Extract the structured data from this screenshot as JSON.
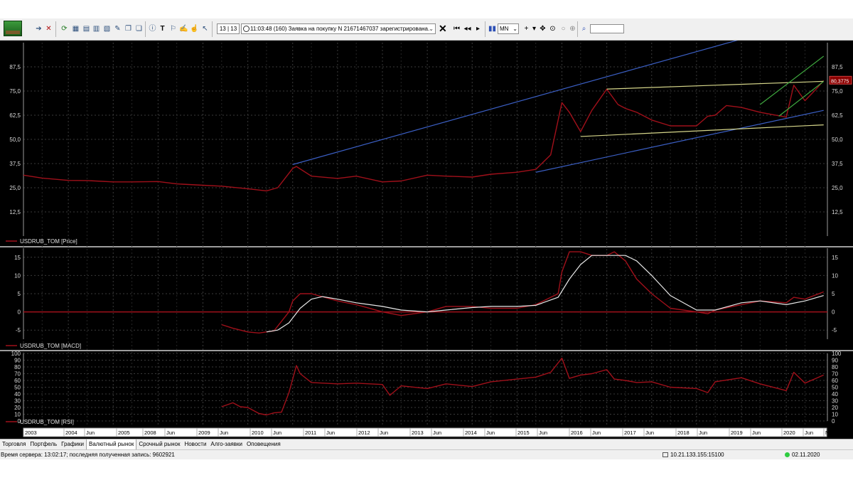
{
  "toolbar": {
    "counter": "13 | 13",
    "message": "11:03:48  (160) Заявка на покупку N 21671467037 зарегистрирована.",
    "timeframe": "MN",
    "icons": [
      "logo-icon",
      "arrow-right-icon",
      "cancel-order-icon",
      "refresh-icon",
      "table-icon",
      "table-icon",
      "table-icon",
      "chart-icon",
      "edit-icon",
      "copy-icon",
      "info-icon",
      "text-tool-icon",
      "draw-tool-icon",
      "draw-tool-icon",
      "draw-tool-icon",
      "cursor-icon",
      "first-icon",
      "prev-icon",
      "next-icon",
      "last-icon",
      "candles-icon",
      "crosshair-icon",
      "move-icon",
      "target-icon",
      "circle-icon",
      "zoom-icon",
      "search-icon"
    ]
  },
  "tabs": [
    "Торговля",
    "Портфель",
    "Графики",
    "Валютный рынок",
    "Срочный рынок",
    "Новости",
    "Алго-заявки",
    "Оповещения"
  ],
  "active_tab": "Валютный рынок",
  "status": {
    "server_time": "Время сервера: 13:02:17; последняя полученная запись: 9602921",
    "connection": "10.21.133.155:15100",
    "date": "02.11.2020"
  },
  "colors": {
    "price_line": "#a0101a",
    "signal_line": "#e8e8e8",
    "trend_blue": "#3b5fc4",
    "trend_yellow": "#d6d68a",
    "trend_green": "#3fa83f",
    "grid": "#3a3a3a",
    "zero_line": "#a0101a"
  },
  "chart_data": [
    {
      "type": "line",
      "legend": "USDRUB_TOM [Price]",
      "ylim": [
        0,
        100
      ],
      "yticks": [
        "12,5",
        "25,0",
        "37,5",
        "50,0",
        "62,5",
        "75,0",
        "87,5"
      ],
      "last_value": "80,3775",
      "x": [
        "2003-01",
        "2003-06",
        "2004-01",
        "2004-06",
        "2005-01",
        "2005-06",
        "2006-01",
        "2006-06",
        "2007-01",
        "2007-06",
        "2008-01",
        "2008-06",
        "2008-09",
        "2009-01",
        "2009-02",
        "2009-06",
        "2010-01",
        "2010-06",
        "2011-01",
        "2011-06",
        "2012-01",
        "2012-06",
        "2013-01",
        "2013-06",
        "2014-01",
        "2014-06",
        "2014-10",
        "2014-12",
        "2015-01",
        "2015-03",
        "2015-06",
        "2015-09",
        "2016-01",
        "2016-04",
        "2016-06",
        "2016-09",
        "2017-01",
        "2017-06",
        "2018-01",
        "2018-04",
        "2018-06",
        "2018-09",
        "2019-01",
        "2019-06",
        "2020-01",
        "2020-03",
        "2020-06",
        "2020-09",
        "2020-11"
      ],
      "values": [
        31.5,
        30,
        28.8,
        28.7,
        28,
        28,
        28.2,
        27,
        26.3,
        25.8,
        24.5,
        23.4,
        25,
        35,
        36,
        31,
        29.8,
        31,
        28,
        28.5,
        31.5,
        31,
        30.5,
        32,
        33,
        34.5,
        42,
        60,
        69,
        64,
        54,
        65,
        76,
        68,
        66,
        64,
        60,
        57,
        57,
        62,
        62.5,
        67.5,
        66.5,
        64,
        61.5,
        78,
        70,
        76,
        80.4
      ]
    },
    {
      "type": "line",
      "legend": "USDRUB_TOM [MACD]",
      "ylim": [
        -7.5,
        17.5
      ],
      "yticks": [
        "-5",
        "0",
        "5",
        "10",
        "15"
      ],
      "series": [
        {
          "x": [
            "2007-06",
            "2007-09",
            "2008-01",
            "2008-04",
            "2008-08",
            "2008-12",
            "2009-01",
            "2009-03",
            "2009-06",
            "2010-01",
            "2010-06",
            "2011-01",
            "2011-06",
            "2012-01",
            "2012-06",
            "2013-01",
            "2013-06",
            "2014-01",
            "2014-06",
            "2014-12",
            "2015-01",
            "2015-03",
            "2015-06",
            "2015-09",
            "2016-01",
            "2016-03",
            "2016-06",
            "2016-09",
            "2017-01",
            "2017-06",
            "2018-01",
            "2018-04",
            "2018-06",
            "2019-01",
            "2019-06",
            "2020-01",
            "2020-03",
            "2020-06",
            "2020-11"
          ],
          "values": [
            -3.5,
            -4.5,
            -5.5,
            -5.8,
            -5.2,
            0,
            3,
            5,
            5,
            3,
            2,
            0,
            -1,
            0,
            1.5,
            1.5,
            1,
            1,
            2,
            5,
            11,
            16.5,
            16.5,
            15.5,
            15.5,
            16.5,
            14,
            9,
            5,
            1,
            0,
            -0.5,
            0.5,
            2,
            3,
            2.5,
            4,
            3.5,
            5.5
          ]
        },
        {
          "x": [
            "2008-06",
            "2008-09",
            "2008-12",
            "2009-03",
            "2009-06",
            "2009-09",
            "2010-01",
            "2010-06",
            "2011-01",
            "2011-06",
            "2012-01",
            "2012-06",
            "2013-01",
            "2013-06",
            "2014-01",
            "2014-06",
            "2014-12",
            "2015-03",
            "2015-06",
            "2015-09",
            "2016-01",
            "2016-03",
            "2016-06",
            "2016-09",
            "2017-01",
            "2017-06",
            "2018-01",
            "2018-06",
            "2019-01",
            "2019-06",
            "2020-01",
            "2020-06",
            "2020-11"
          ],
          "values": [
            -5.5,
            -5,
            -3,
            1,
            3.5,
            4.2,
            3.5,
            2.5,
            1.5,
            0.5,
            0,
            0.5,
            1.2,
            1.5,
            1.5,
            1.8,
            4,
            9,
            13,
            15.5,
            15.5,
            15.5,
            15.5,
            14,
            10,
            4.5,
            0.5,
            0.5,
            2.5,
            3,
            2,
            3,
            4.5
          ]
        }
      ]
    },
    {
      "type": "line",
      "legend": "USDRUB_TOM [RSI]",
      "ylim": [
        0,
        100
      ],
      "yticks": [
        "0",
        "10",
        "20",
        "30",
        "40",
        "50",
        "60",
        "70",
        "80",
        "90",
        "100"
      ],
      "x": [
        "2007-06",
        "2007-09",
        "2007-11",
        "2008-01",
        "2008-04",
        "2008-06",
        "2008-08",
        "2008-10",
        "2008-12",
        "2009-02",
        "2009-03",
        "2009-06",
        "2010-01",
        "2010-06",
        "2011-01",
        "2011-03",
        "2011-06",
        "2012-01",
        "2012-06",
        "2013-01",
        "2013-06",
        "2014-01",
        "2014-06",
        "2014-10",
        "2015-01",
        "2015-03",
        "2015-06",
        "2015-09",
        "2016-01",
        "2016-03",
        "2016-06",
        "2016-09",
        "2017-01",
        "2017-06",
        "2018-01",
        "2018-04",
        "2018-06",
        "2019-01",
        "2019-06",
        "2020-01",
        "2020-03",
        "2020-06",
        "2020-11"
      ],
      "values": [
        21,
        27,
        21,
        20,
        11,
        9,
        12,
        13,
        42,
        82,
        70,
        57,
        55,
        56,
        54,
        38,
        52,
        48,
        55,
        51,
        58,
        62,
        65,
        72,
        93,
        63,
        68,
        70,
        76,
        62,
        60,
        57,
        58,
        50,
        48,
        42,
        58,
        64,
        55,
        45,
        72,
        56,
        68
      ]
    }
  ],
  "x_axis_labels": [
    "2003",
    "2004",
    "Jun",
    "2005",
    "2008",
    "Jun",
    "2009",
    "Jun",
    "2010",
    "Jun",
    "2011",
    "Jun",
    "2012",
    "Jun",
    "2013",
    "Jun",
    "2014",
    "Jun",
    "2015",
    "Jun",
    "2016",
    "Jun",
    "2017",
    "Jun",
    "2018",
    "Jun",
    "2019",
    "Jun",
    "2020",
    "Jun",
    "Nov"
  ]
}
